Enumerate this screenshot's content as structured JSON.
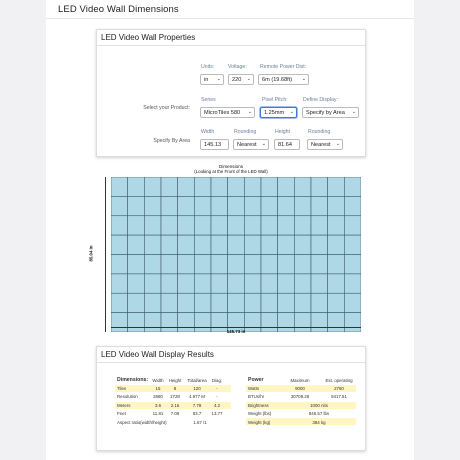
{
  "page": {
    "title": "LED Video Wall Dimensions"
  },
  "properties": {
    "title": "LED Video Wall Properties",
    "units": {
      "label": "Units:",
      "value": "in"
    },
    "voltage": {
      "label": "Voltage:",
      "value": "220"
    },
    "remote_power": {
      "label": "Remote Power Dist:",
      "value": "6m (19.68ft)"
    },
    "select_product_label": "Select your Product:",
    "series": {
      "label": "Series",
      "value": "MicroTiles 580"
    },
    "pixel_pitch": {
      "label": "Pixel Pitch:",
      "value": "1.25mm"
    },
    "define_display": {
      "label": "Define Display:",
      "value": "Specify by Area"
    },
    "specify_by_area_label": "Specify By Area",
    "width": {
      "label": "Width",
      "value": "145.13"
    },
    "rounding_w": {
      "label": "Rounding",
      "value": "Nearest"
    },
    "height": {
      "label": "Height",
      "value": "81.64"
    },
    "rounding_h": {
      "label": "Rounding",
      "value": "Nearest"
    }
  },
  "diagram": {
    "title": "Dimensions",
    "subtitle": "(Looking at the Front of the LED Wall)",
    "width_label": "145.73 in",
    "height_label": "85.04 in",
    "cols": 15,
    "rows": 8,
    "tile_color": "#aed8e6",
    "line_color": "#3d5a6a"
  },
  "results": {
    "title": "LED Video Wall Display Results",
    "dimensions": {
      "heading": "Dimensions:",
      "columns": [
        "Width",
        "Height",
        "Total/area",
        "Diag."
      ],
      "rows": [
        {
          "label": "Tiles",
          "values": [
            "15",
            "8",
            "120",
            "-"
          ]
        },
        {
          "label": "Resolution",
          "values": [
            "2880",
            "1728",
            "4.977 M",
            "-"
          ]
        },
        {
          "label": "Meters",
          "values": [
            "3.6",
            "2.16",
            "7.78",
            "4.2"
          ]
        },
        {
          "label": "Feet",
          "values": [
            "11.81",
            "7.09",
            "83.7",
            "13.77"
          ]
        }
      ],
      "aspect_label": "Aspect ratio(width/height)",
      "aspect_value": "1.67 /1"
    },
    "power": {
      "heading": "Power",
      "columns": [
        "Maximum",
        "Est. operating"
      ],
      "rows": [
        {
          "label": "Watts",
          "values": [
            "9000",
            "2760"
          ]
        },
        {
          "label": "BTUs/hr",
          "values": [
            "30709.28",
            "9417.51"
          ]
        },
        {
          "label": "Brightness",
          "values": [
            "1000 nits"
          ]
        },
        {
          "label": "Weight (lbs)",
          "values": [
            "846.57 lbs"
          ]
        },
        {
          "label": "Weight (kg)",
          "values": [
            "384 kg"
          ]
        }
      ]
    }
  }
}
